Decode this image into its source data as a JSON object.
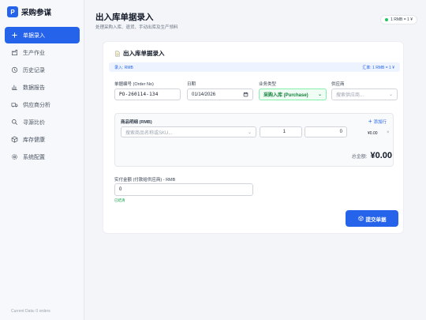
{
  "brand": {
    "logo_letter": "P",
    "name": "采购参谋"
  },
  "nav": [
    {
      "label": "单据录入",
      "icon": "plus-icon",
      "active": true
    },
    {
      "label": "生产作业",
      "icon": "factory-icon"
    },
    {
      "label": "历史记录",
      "icon": "clock-icon"
    },
    {
      "label": "数据报告",
      "icon": "bar-chart-icon"
    },
    {
      "label": "供应商分析",
      "icon": "truck-icon"
    },
    {
      "label": "寻源比价",
      "icon": "search-icon"
    },
    {
      "label": "库存健康",
      "icon": "box-icon"
    },
    {
      "label": "系统配置",
      "icon": "gear-icon"
    }
  ],
  "sidebar_footer": "Current Data: 0 orders",
  "header": {
    "title": "出入库单据录入",
    "subtitle": "处理采购入库、退货、手动出库及生产领料",
    "rate_pill": "1 RMB = 1 ¥"
  },
  "card": {
    "title": "出入库单据录入",
    "entry_label": "录入: RMB",
    "exchange_rate": "汇率: 1 RMB = 1 ¥"
  },
  "form": {
    "order_no_label": "单据编号 (Order No)",
    "order_no_value": "PO-260114-134",
    "date_label": "日期",
    "date_value": "01/14/2026",
    "type_label": "业务类型",
    "type_value": "采购入库 (Purchase)",
    "supplier_label": "供应商",
    "supplier_placeholder": "搜索供应商..."
  },
  "items": {
    "heading": "商品明细 (RMB)",
    "add_row_label": "添加行",
    "sku_placeholder": "搜索商品名称或SKU...",
    "qty_value": "1",
    "price_value": "0",
    "line_total": "¥0.00",
    "remove_symbol": "×",
    "total_label": "总金额:",
    "total_value": "¥0.00"
  },
  "payment": {
    "label": "实付金额 (付款给供应商) - RMB",
    "value": "0",
    "hint": "已结清"
  },
  "submit_label": "提交单据",
  "colors": {
    "accent": "#2563eb",
    "success": "#16a34a"
  }
}
